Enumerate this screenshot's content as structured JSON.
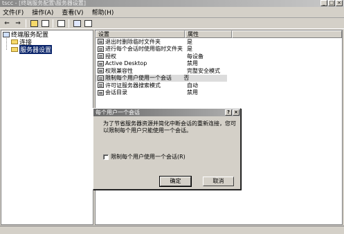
{
  "window": {
    "title": "tscc - [终端服务配置\\服务器设置]",
    "controls": [
      "_",
      "□",
      "×"
    ]
  },
  "menu": [
    "文件(F)",
    "操作(A)",
    "查看(V)",
    "帮助(H)"
  ],
  "toolbar": {
    "icons": [
      "back-icon",
      "forward-icon",
      "up-folder-icon",
      "show-tree-icon",
      "properties-icon",
      "help-icon",
      "console-icon"
    ],
    "glyphs": [
      "⇐",
      "⇒"
    ]
  },
  "tree": {
    "root": "终端服务配置",
    "children": [
      "连接",
      "服务器设置"
    ],
    "selected": "服务器设置"
  },
  "list": {
    "columns": [
      "设置",
      "属性"
    ],
    "rows": [
      {
        "setting": "退出时删除临时文件夹",
        "value": "是"
      },
      {
        "setting": "进行每个会话时使用临时文件夹",
        "value": "是"
      },
      {
        "setting": "授权",
        "value": "每设备"
      },
      {
        "setting": "Active Desktop",
        "value": "禁用"
      },
      {
        "setting": "权限兼容性",
        "value": "完整安全模式"
      },
      {
        "setting": "限制每个用户使用一个会话",
        "value": "否"
      },
      {
        "setting": "许可证服务器搜索模式",
        "value": "自动"
      },
      {
        "setting": "会话目录",
        "value": "禁用"
      }
    ],
    "highlighted_row": 5
  },
  "dialog": {
    "title": "每个用户一个会话",
    "title_buttons": [
      "?",
      "×"
    ],
    "message": "为了节省服务器资源并简化中断会话的重新连接，您可以限制每个用户只能使用一个会话。",
    "checkbox_label": "限制每个用户使用一个会话(R)",
    "checkbox_checked": false,
    "ok_label": "确定",
    "cancel_label": "取消"
  }
}
